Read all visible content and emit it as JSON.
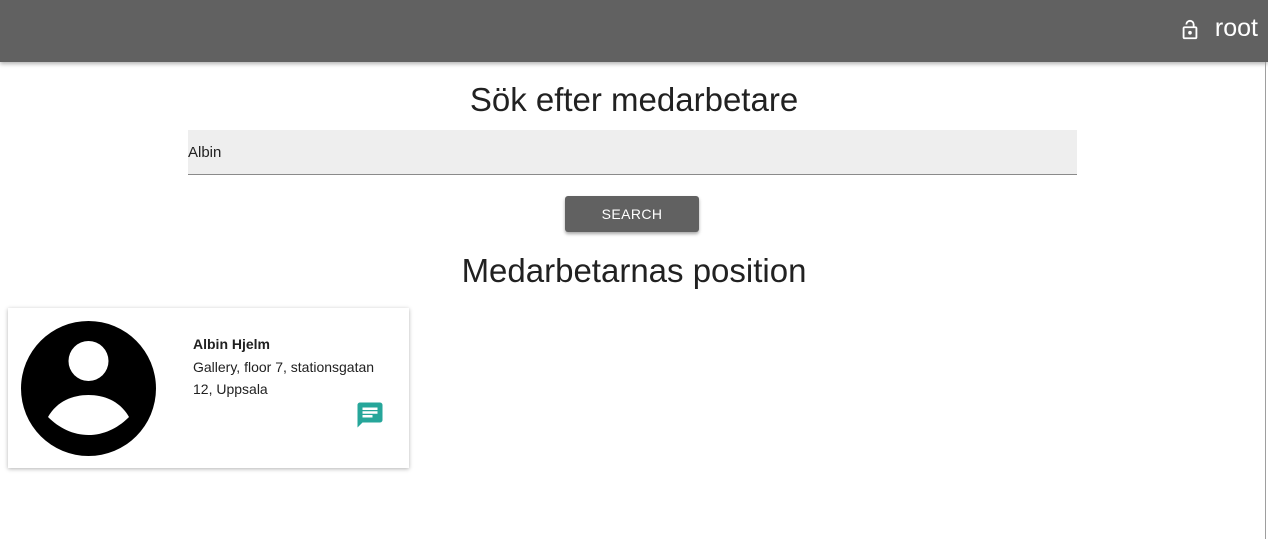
{
  "header": {
    "username": "root",
    "lock_icon": "lock-open-icon"
  },
  "search": {
    "title": "Sök efter medarbetare",
    "value": "Albin",
    "button_label": "SEARCH"
  },
  "results": {
    "title": "Medarbetarnas position",
    "employees": [
      {
        "name": "Albin Hjelm",
        "location": "Gallery, floor 7, stationsgatan 12, Uppsala",
        "avatar_icon": "account-circle-icon",
        "action_icon": "message-icon"
      }
    ]
  },
  "colors": {
    "header_bg": "#616161",
    "button_bg": "#616161",
    "accent": "#26a69a"
  }
}
